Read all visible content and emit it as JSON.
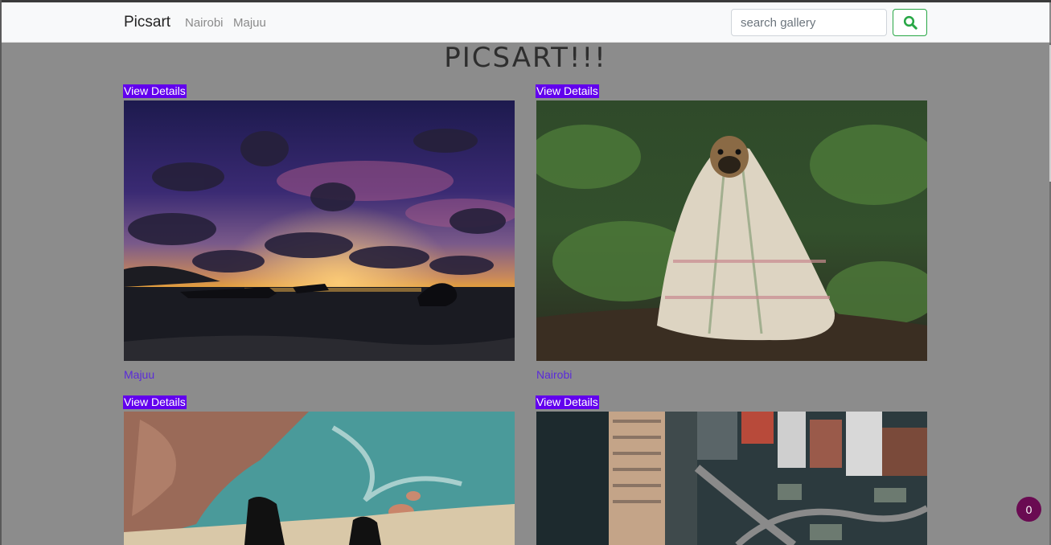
{
  "navbar": {
    "brand": "Picsart",
    "links": [
      "Nairobi",
      "Majuu"
    ],
    "search_placeholder": "search gallery",
    "search_button_icon": "search-icon"
  },
  "page_title": "PICSART!!!",
  "gallery": [
    {
      "action": "View Details",
      "caption": "Majuu",
      "image": "sunset-beach-boats"
    },
    {
      "action": "View Details",
      "caption": "Nairobi",
      "image": "pug-in-blanket"
    },
    {
      "action": "View Details",
      "caption": "",
      "image": "cliff-sea-feet"
    },
    {
      "action": "View Details",
      "caption": "",
      "image": "city-aerial"
    }
  ],
  "notification_badge": "0",
  "colors": {
    "overlay": "#8c8c8c",
    "view_details_bg": "#6200ee",
    "caption": "#5b2bd9",
    "search_button_border": "#28a745",
    "badge": "#6a0b52"
  }
}
